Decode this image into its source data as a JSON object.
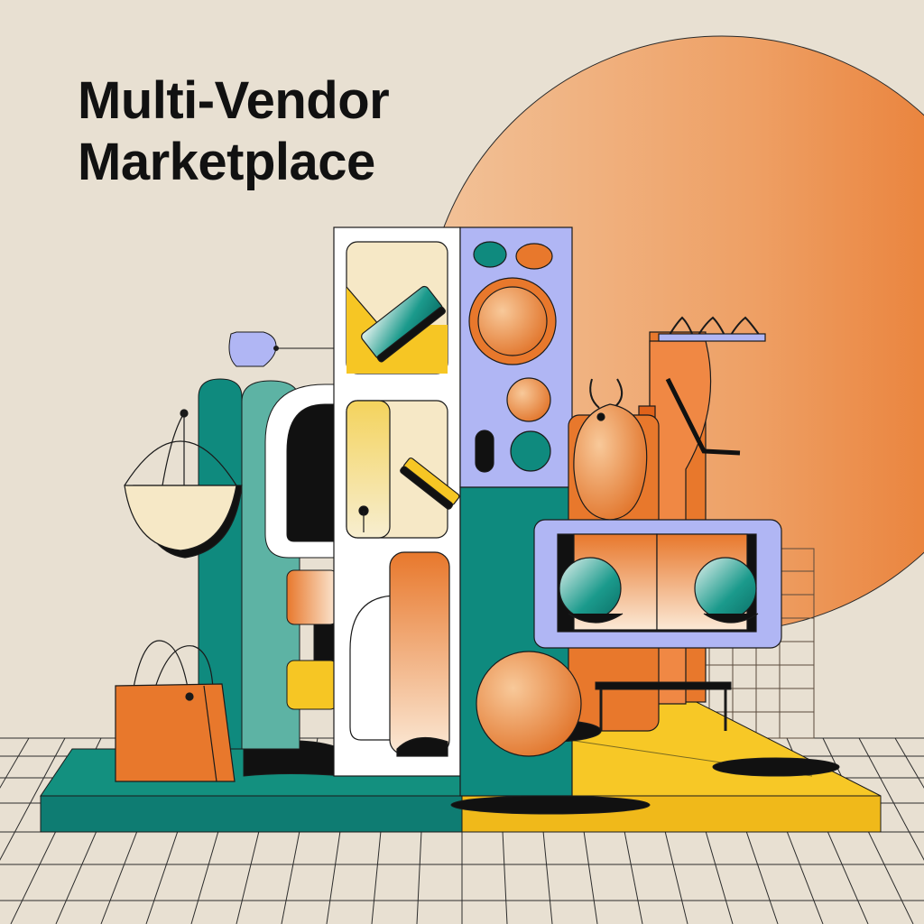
{
  "title": {
    "line1": "Multi-Vendor",
    "line2": "Marketplace"
  },
  "palette": {
    "background": "#e8e0d2",
    "orange": "#e8782c",
    "teal": "#0f8a7e",
    "yellow": "#f6c624",
    "lavender": "#b0b6f4",
    "cream": "#f6e8c6",
    "ink": "#111111"
  },
  "icons": [
    "sun-circle-icon",
    "shopping-bag-icon",
    "hanging-basket-icon",
    "price-tag-icon",
    "clothes-hanger-icon",
    "sphere-icon",
    "product-shelf-icon"
  ]
}
